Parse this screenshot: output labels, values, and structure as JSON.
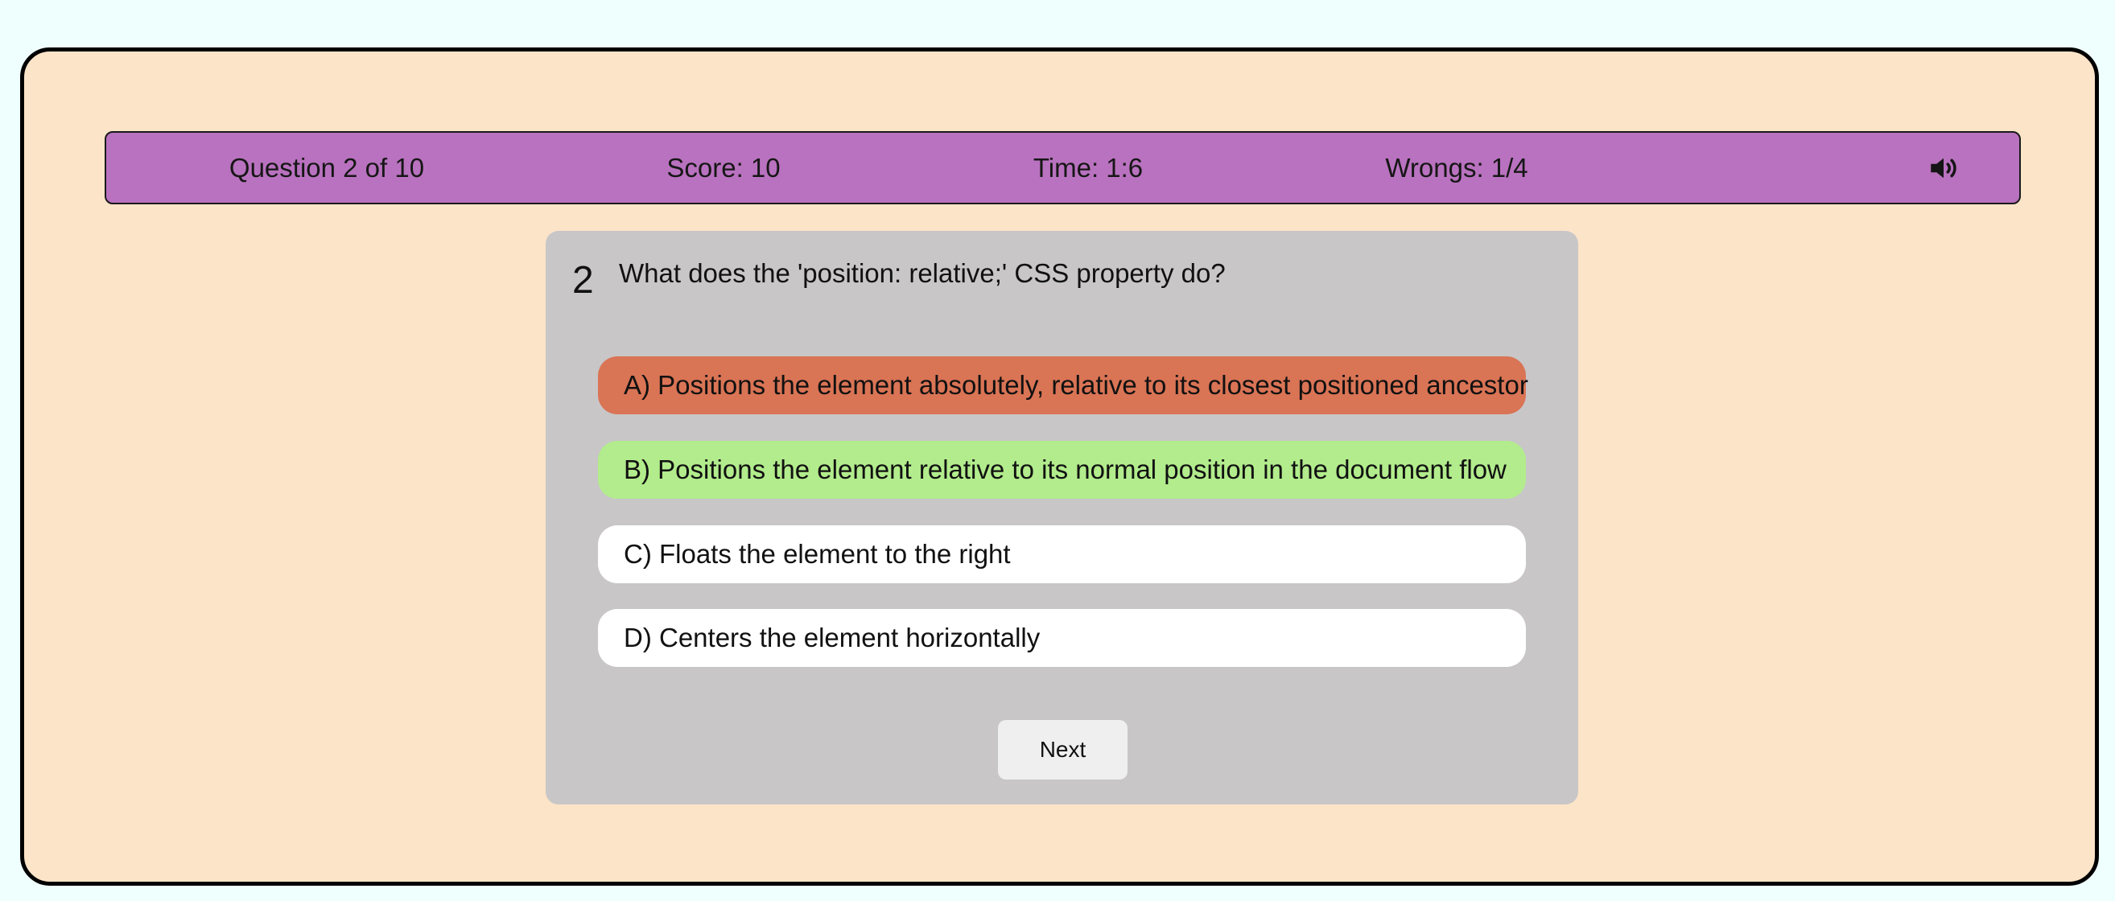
{
  "status": {
    "question_progress": "Question 2 of 10",
    "score": "Score: 10",
    "time": "Time: 1:6",
    "wrongs": "Wrongs: 1/4",
    "sound_icon": "speaker-volume-icon"
  },
  "question": {
    "number": "2",
    "text": "What does the 'position: relative;' CSS property do?"
  },
  "options": [
    {
      "label": "A) Positions the element absolutely, relative to its closest positioned ancestor",
      "state": "wrong",
      "color": "#d97455"
    },
    {
      "label": "B) Positions the element relative to its normal position in the document flow",
      "state": "correct",
      "color": "#b2ec8c"
    },
    {
      "label": "C) Floats the element to the right",
      "state": "neutral",
      "color": "#ffffff"
    },
    {
      "label": "D) Centers the element horizontally",
      "state": "neutral",
      "color": "#ffffff"
    }
  ],
  "next_button": "Next",
  "colors": {
    "background": "#effffe",
    "frame": "#fce4c8",
    "status_bar": "#b972bf",
    "card": "#c8c6c7"
  }
}
